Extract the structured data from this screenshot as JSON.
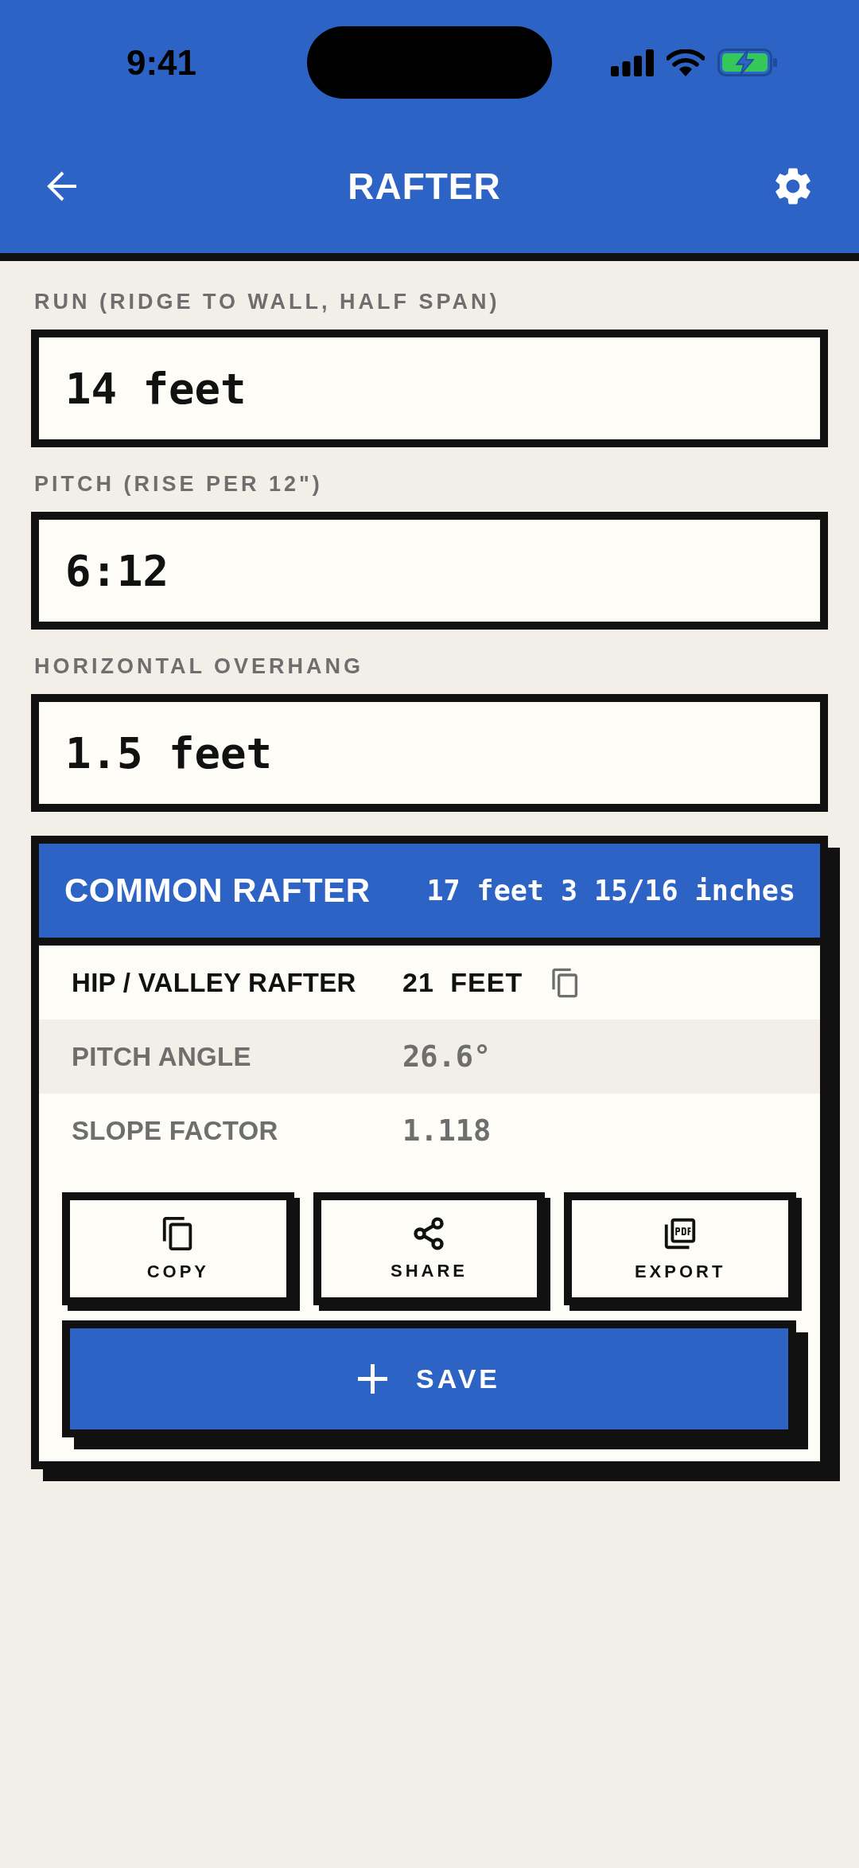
{
  "status_bar": {
    "time": "9:41"
  },
  "app_bar": {
    "title": "RAFTER"
  },
  "fields": [
    {
      "label": "RUN (RIDGE TO WALL, HALF SPAN)",
      "value": "14 feet"
    },
    {
      "label": "PITCH (RISE PER 12\")",
      "value": "6:12"
    },
    {
      "label": "HORIZONTAL OVERHANG",
      "value": "1.5 feet"
    }
  ],
  "result": {
    "title": "COMMON RAFTER",
    "value": "17 feet 3 15/16 inches",
    "rows": [
      {
        "kind": "primary",
        "label": "HIP / VALLEY RAFTER",
        "value": "21 FEET"
      },
      {
        "kind": "secondary",
        "label": "PITCH ANGLE",
        "value": "26.6°"
      },
      {
        "kind": "secondary",
        "label": "SLOPE FACTOR",
        "value": "1.118"
      }
    ],
    "actions": [
      {
        "kind": "copy",
        "label": "COPY"
      },
      {
        "kind": "share",
        "label": "SHARE"
      },
      {
        "kind": "export",
        "label": "EXPORT"
      }
    ],
    "save_button": {
      "label": "SAVE"
    }
  }
}
